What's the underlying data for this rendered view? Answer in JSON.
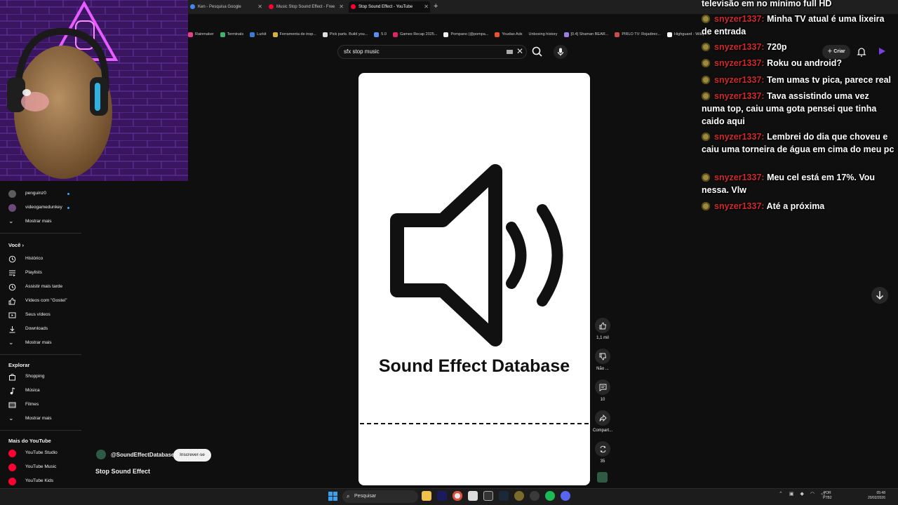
{
  "browser": {
    "tabs": [
      {
        "label": "Ken - Pesquisa Google",
        "color": "#4285f4"
      },
      {
        "label": "Music Stop Sound Effect - Free",
        "color": "#ff0033"
      },
      {
        "label": "Stop Sound Effect - YouTube",
        "color": "#ff0033",
        "active": true
      }
    ],
    "new_tab": "+",
    "bookmarks": [
      "Rainmaker",
      "Terminals",
      "Lurkit",
      "Ferramenta de insp...",
      "Pick parts. Build you...",
      "5.0",
      "Games Recap 2025...",
      "Pompano (@pompa...",
      "Youdao Ads",
      "Unboxing history",
      "[0.4] Shaman BEAR...",
      "PIRLO TV: Rojadirec...",
      "Highguard - Wikipé..."
    ]
  },
  "header": {
    "search_value": "sfx stop music",
    "create_label": "Criar"
  },
  "sidebar": {
    "subscriptions": [
      {
        "name": "penguinz0"
      },
      {
        "name": "videogamedunkey"
      }
    ],
    "show_more": "Mostrar mais",
    "you_heading": "Você",
    "you_items": [
      {
        "label": "Histórico",
        "icon": "history-icon"
      },
      {
        "label": "Playlists",
        "icon": "playlist-icon"
      },
      {
        "label": "Assistir mais tarde",
        "icon": "clock-icon"
      },
      {
        "label": "Vídeos com \"Gostei\"",
        "icon": "like-icon"
      },
      {
        "label": "Seus vídeos",
        "icon": "video-icon"
      },
      {
        "label": "Downloads",
        "icon": "download-icon"
      },
      {
        "label": "Mostrar mais",
        "icon": "chevron-down-icon"
      }
    ],
    "explore_heading": "Explorar",
    "explore_items": [
      {
        "label": "Shopping",
        "icon": "bag-icon"
      },
      {
        "label": "Música",
        "icon": "music-icon"
      },
      {
        "label": "Filmes",
        "icon": "film-icon"
      },
      {
        "label": "Mostrar mais",
        "icon": "chevron-down-icon"
      }
    ],
    "more_heading": "Mais do YouTube",
    "more_items": [
      {
        "label": "YouTube Studio"
      },
      {
        "label": "YouTube Music"
      },
      {
        "label": "YouTube Kids"
      }
    ]
  },
  "short": {
    "brand_title": "Sound Effect Database",
    "channel": "@SoundEffectDatabase",
    "subscribe": "Inscrever-se",
    "title": "Stop Sound Effect",
    "actions": {
      "likes": "1,1 mil",
      "dislike": "Não ...",
      "comments": "10",
      "share": "Compart...",
      "remix": "35"
    }
  },
  "chat": {
    "messages": [
      {
        "user": "",
        "text": "televisão em no mínimo full HD"
      },
      {
        "user": "snyzer1337:",
        "text": "Minha TV atual é uma lixeira de entrada"
      },
      {
        "user": "snyzer1337:",
        "text": "720p"
      },
      {
        "user": "snyzer1337:",
        "text": "Roku ou android?"
      },
      {
        "user": "snyzer1337:",
        "text": "Tem umas tv pica, parece real"
      },
      {
        "user": "snyzer1337:",
        "text": "Tava assistindo uma vez numa top, caiu uma gota pensei que tinha caido aqui"
      },
      {
        "user": "snyzer1337:",
        "text": "Lembrei do dia que choveu e caiu uma torneira de água em cima do meu pc"
      },
      {
        "user": "snyzer1337:",
        "text": "Meu cel está em 17%. Vou nessa. Vlw"
      },
      {
        "user": "snyzer1337:",
        "text": "Até a próxima"
      }
    ]
  },
  "taskbar": {
    "search_placeholder": "Pesquisar",
    "lang_1": "POR",
    "lang_2": "PTB2",
    "time": "05:48",
    "date": "20/02/2026"
  },
  "colors": {
    "accent": "#ff0033",
    "chat_user": "#d12a2a",
    "background": "#0f0f0f"
  }
}
